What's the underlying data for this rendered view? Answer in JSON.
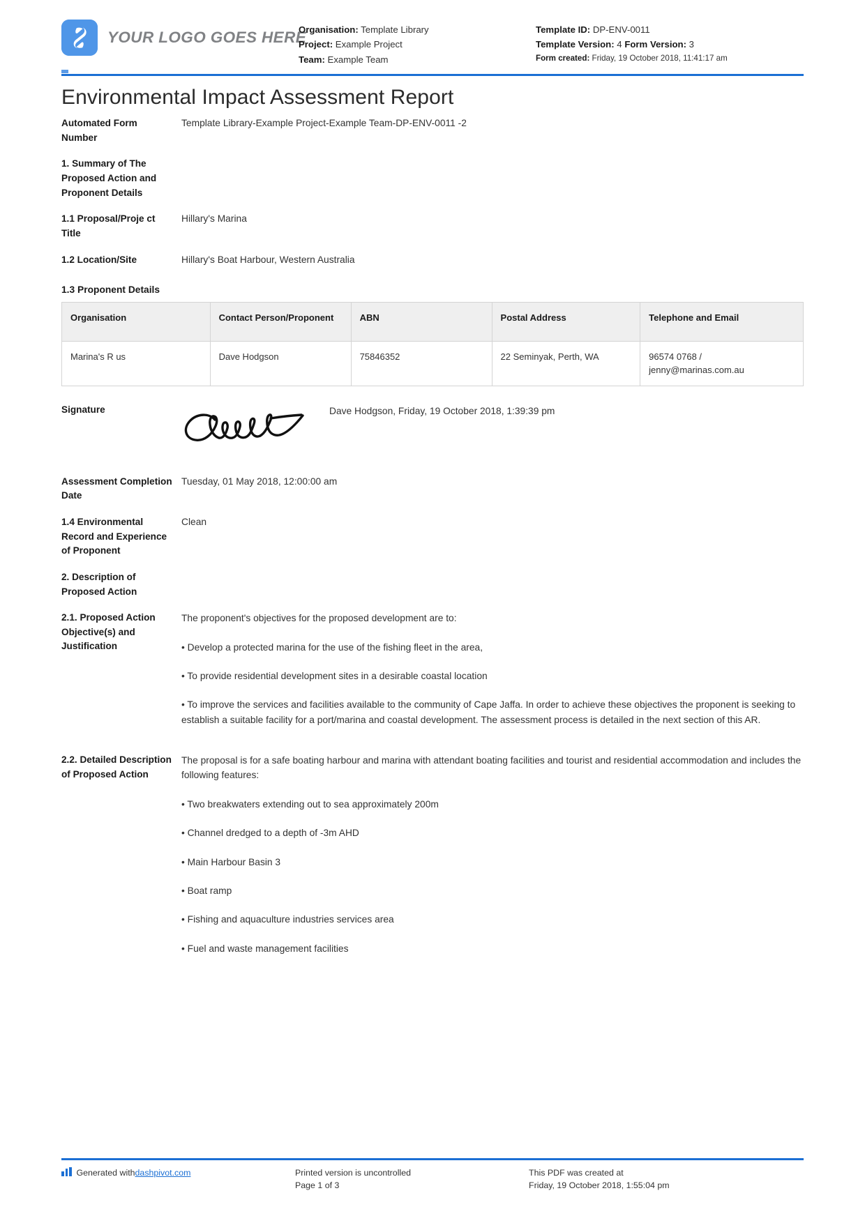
{
  "header": {
    "logo_text": "YOUR LOGO GOES HERE",
    "organisation_label": "Organisation:",
    "organisation_value": "Template Library",
    "project_label": "Project:",
    "project_value": "Example Project",
    "team_label": "Team:",
    "team_value": "Example Team",
    "template_id_label": "Template ID:",
    "template_id_value": "DP-ENV-0011",
    "template_version_label": "Template Version:",
    "template_version_value": "4",
    "form_version_label": "Form Version:",
    "form_version_value": "3",
    "form_created_label": "Form created:",
    "form_created_value": "Friday, 19 October 2018, 11:41:17 am"
  },
  "title": "Environmental Impact Assessment Report",
  "fields": {
    "automated_form_number_label": "Automated Form Number",
    "automated_form_number_value": "Template Library-Example Project-Example Team-DP-ENV-0011   -2",
    "section1_label": "1. Summary of The Proposed Action and Proponent Details",
    "section1_value": "",
    "f11_label": "1.1 Proposal/Proje ct Title",
    "f11_value": "Hillary's Marina",
    "f12_label": "1.2 Location/Site",
    "f12_value": "Hillary's Boat Harbour, Western Australia",
    "f13_heading": "1.3 Proponent Details",
    "signature_label": "Signature",
    "signature_meta": "Dave Hodgson, Friday, 19 October 2018, 1:39:39 pm",
    "assessment_date_label": "Assessment Completion Date",
    "assessment_date_value": "Tuesday, 01 May 2018, 12:00:00 am",
    "f14_label": "1.4 Environmental Record and Experience of Proponent",
    "f14_value": "Clean",
    "section2_label": "2. Description of Proposed Action",
    "section2_value": "",
    "f21_label": "2.1. Proposed Action Objective(s) and Justification",
    "f22_label": "2.2. Detailed Description of Proposed Action"
  },
  "proponent_table": {
    "columns": [
      "Organisation",
      "Contact Person/Proponent",
      "ABN",
      "Postal Address",
      "Telephone and Email"
    ],
    "rows": [
      {
        "organisation": "Marina's R us",
        "contact": "Dave Hodgson",
        "abn": "75846352",
        "address": "22 Seminyak, Perth, WA",
        "telephone_email": "96574 0768 / jenny@marinas.com.au"
      }
    ]
  },
  "section21": {
    "intro": "The proponent's objectives for the proposed development are to:",
    "bullets": [
      "• Develop a protected marina for the use of the fishing fleet in the area,",
      "• To provide residential development sites in a desirable coastal location",
      "• To improve the services and facilities available to the community of Cape Jaffa. In order to achieve these objectives the proponent is seeking to establish a suitable facility for a port/marina and coastal development. The assessment process is detailed in the next section of this AR."
    ]
  },
  "section22": {
    "intro": "The proposal is for a safe boating harbour and marina with attendant boating facilities and tourist and residential accommodation and includes the following features:",
    "bullets": [
      "• Two breakwaters extending out to sea approximately 200m",
      "• Channel dredged to a depth of -3m AHD",
      "• Main Harbour Basin 3",
      "• Boat ramp",
      "• Fishing and aquaculture industries services area",
      "• Fuel and waste management facilities"
    ]
  },
  "footer": {
    "generated_prefix": "Generated with ",
    "generated_link": "dashpivot.com",
    "printed_notice": "Printed version is uncontrolled",
    "page_number": "Page 1 of 3",
    "created_label": "This PDF was created at",
    "created_value": "Friday, 19 October 2018, 1:55:04 pm"
  },
  "colors": {
    "accent_blue": "#1b6fd4",
    "logo_blue": "#4f96e8",
    "table_header_bg": "#efefef"
  }
}
